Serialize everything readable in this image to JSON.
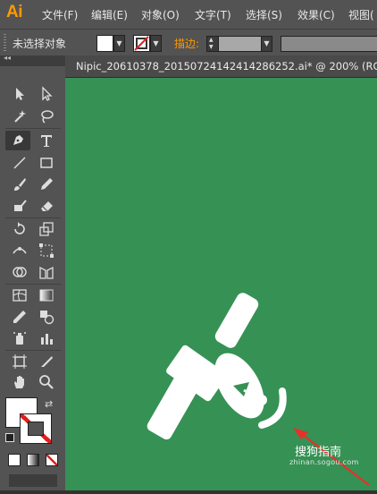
{
  "app": {
    "logo": "Ai"
  },
  "menu": {
    "items": [
      "文件(F)",
      "编辑(E)",
      "对象(O)",
      "文字(T)",
      "选择(S)",
      "效果(C)",
      "视图("
    ]
  },
  "control_bar": {
    "selection_label": "未选择对象",
    "stroke_label": "描边:"
  },
  "document": {
    "tab_title": "Nipic_20610378_20150724142414286252.ai*  @  200%  (RG"
  },
  "watermark": {
    "text": "搜狗指南",
    "sub": "zhinan.sogou.com"
  },
  "colors": {
    "canvas": "#369155",
    "panel": "#535353",
    "accent": "#ff9a00",
    "arrow": "#e8302a"
  }
}
